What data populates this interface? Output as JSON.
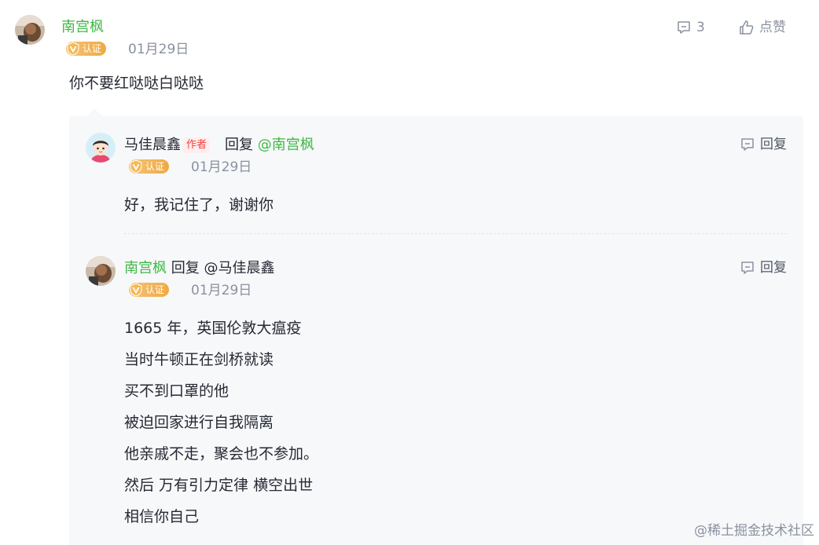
{
  "comment": {
    "author": "南宫枫",
    "badge": "认证",
    "date": "01月29日",
    "text": "你不要红哒哒白哒哒",
    "reply_count": "3",
    "like_label": "点赞"
  },
  "replies": [
    {
      "author": "马佳晨鑫",
      "author_tag": "作者",
      "reply_word": "回复",
      "mention": "@南宫枫",
      "badge": "认证",
      "date": "01月29日",
      "text_lines": [
        "好，我记住了，谢谢你"
      ],
      "reply_label": "回复"
    },
    {
      "author": "南宫枫",
      "reply_word": "回复",
      "mention": "@马佳晨鑫",
      "badge": "认证",
      "date": "01月29日",
      "text_lines": [
        "1665 年，英国伦敦大瘟疫",
        "当时牛顿正在剑桥就读",
        "买不到口罩的他",
        "被迫回家进行自我隔离",
        "他亲戚不走，聚会也不参加。",
        "然后 万有引力定律 横空出世",
        "相信你自己"
      ],
      "reply_label": "回复"
    }
  ],
  "watermark": "@稀土掘金技术社区",
  "colors": {
    "accent_green": "#3fb845",
    "badge_gold": "#f0a941",
    "author_tag_red": "#f53f3f",
    "muted_gray": "#8a919f",
    "reply_bg": "#f7f8fa"
  }
}
